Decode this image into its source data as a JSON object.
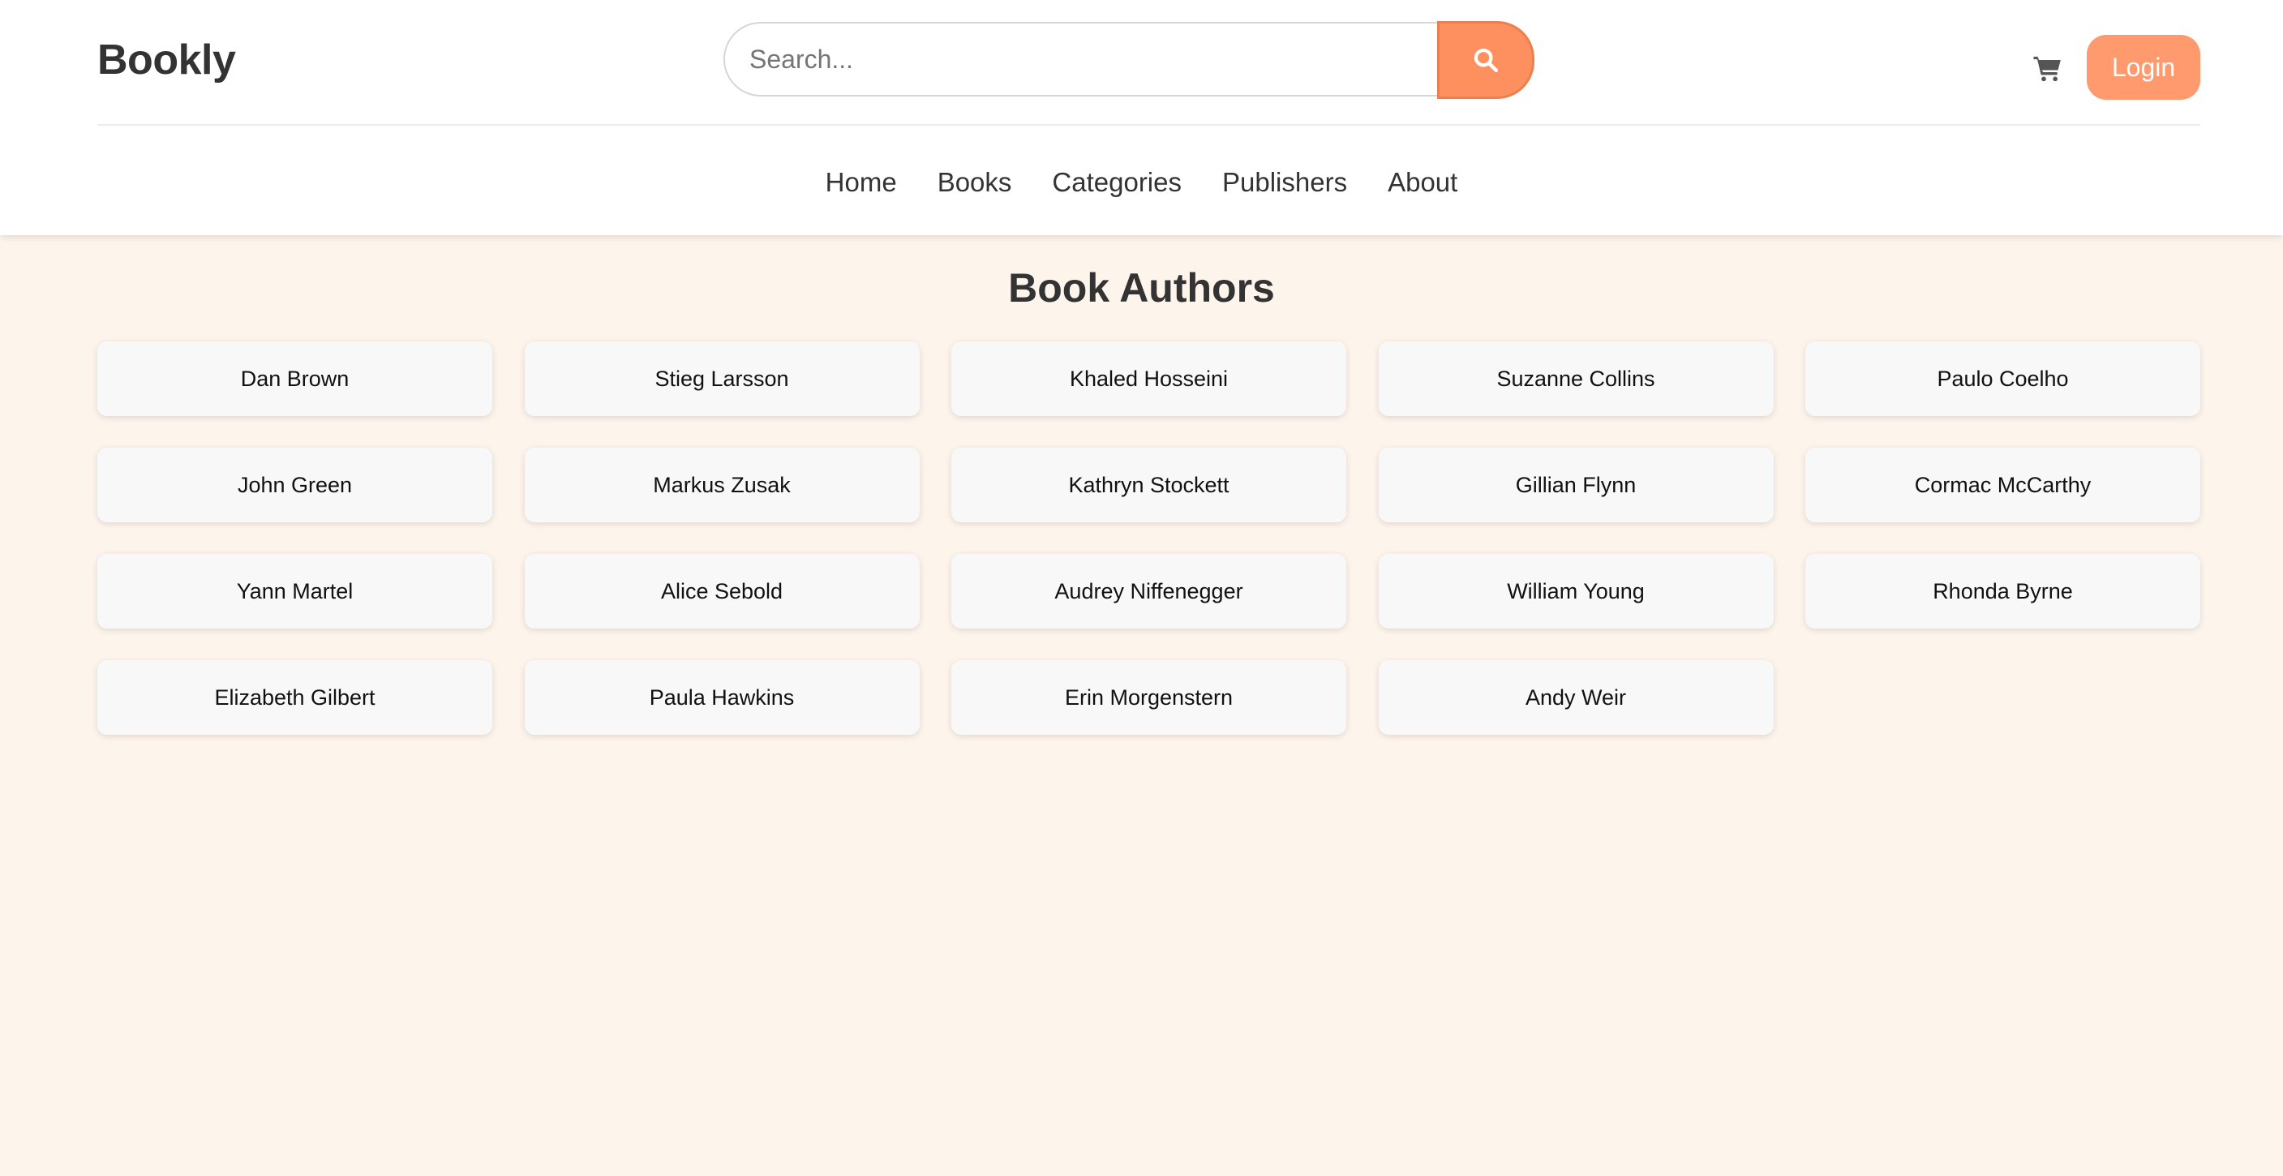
{
  "header": {
    "brand": "Bookly",
    "search": {
      "placeholder": "Search...",
      "value": "",
      "button_icon": "search-icon"
    },
    "cart_icon": "cart-icon",
    "login_label": "Login"
  },
  "nav": {
    "items": [
      {
        "label": "Home"
      },
      {
        "label": "Books"
      },
      {
        "label": "Categories"
      },
      {
        "label": "Publishers"
      },
      {
        "label": "About"
      }
    ]
  },
  "main": {
    "title": "Book Authors",
    "authors": [
      "Dan Brown",
      "Stieg Larsson",
      "Khaled Hosseini",
      "Suzanne Collins",
      "Paulo Coelho",
      "John Green",
      "Markus Zusak",
      "Kathryn Stockett",
      "Gillian Flynn",
      "Cormac McCarthy",
      "Yann Martel",
      "Alice Sebold",
      "Audrey Niffenegger",
      "William Young",
      "Rhonda Byrne",
      "Elizabeth Gilbert",
      "Paula Hawkins",
      "Erin Morgenstern",
      "Andy Weir"
    ]
  },
  "colors": {
    "accent": "#fe9060",
    "login": "#fe9a6d",
    "background": "#fdf4eb",
    "card": "#f8f8f8",
    "header": "#ffffff"
  }
}
